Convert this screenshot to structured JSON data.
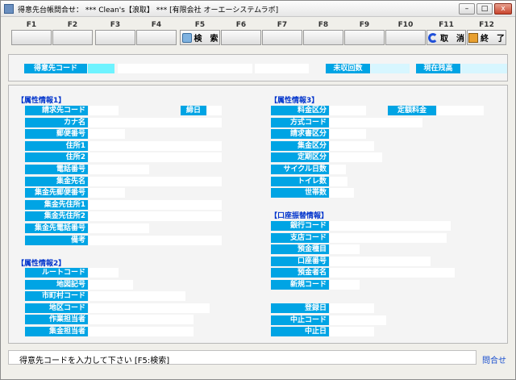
{
  "window": {
    "title": "得意先台帳問合せ：  *** Clean's【浪取】 *** [有限会社  オーエーシステムラボ]",
    "minimize": "–",
    "maximize": "□",
    "close": "x"
  },
  "fkeys": [
    {
      "key": "F1",
      "label": ""
    },
    {
      "key": "F2",
      "label": ""
    },
    {
      "key": "F3",
      "label": ""
    },
    {
      "key": "F4",
      "label": ""
    },
    {
      "key": "F5",
      "label": "検　索",
      "icon": "search-icon"
    },
    {
      "key": "F6",
      "label": ""
    },
    {
      "key": "F7",
      "label": ""
    },
    {
      "key": "F8",
      "label": ""
    },
    {
      "key": "F9",
      "label": ""
    },
    {
      "key": "F10",
      "label": ""
    },
    {
      "key": "F11",
      "label": "取　消",
      "icon": "undo-icon"
    },
    {
      "key": "F12",
      "label": "終　了",
      "icon": "exit-icon"
    }
  ],
  "header": {
    "customer_code_label": "得意先コード",
    "customer_code_value": "",
    "unpaid_count_label": "未収回数",
    "current_balance_label": "現在残高"
  },
  "attr1": {
    "title": "【属性情報1】",
    "labels": [
      "請求先コード",
      "カナ名",
      "郵便番号",
      "住所1",
      "住所2",
      "電話番号",
      "集金先名",
      "集金先郵便番号",
      "集金先住所1",
      "集金先住所2",
      "集金先電話番号",
      "備考"
    ],
    "closing_label": "締日"
  },
  "attr2": {
    "title": "【属性情報2】",
    "labels": [
      "ルートコード",
      "地図記号",
      "市町村コード",
      "地区コード",
      "作業担当者",
      "集金担当者"
    ]
  },
  "attr3": {
    "title": "【属性情報3】",
    "labels": [
      "料金区分",
      "方式コード",
      "請求書区分",
      "集金区分",
      "定期区分",
      "サイクル日数",
      "トイレ数",
      "世帯数"
    ],
    "fixed_fee_label": "定額料金"
  },
  "bank": {
    "title": "【口座振替情報】",
    "labels": [
      "銀行コード",
      "支店コード",
      "預金種目",
      "口座番号",
      "預金者名",
      "新規コード"
    ]
  },
  "dates": {
    "labels": [
      "登録日",
      "中止コード",
      "中止日"
    ]
  },
  "status": {
    "message": "得意先コードを入力して下さい [F5:検索]",
    "inquiry": "問合せ"
  },
  "colors": {
    "label_bg": "#00a4e4",
    "section_title": "#0033cc",
    "input_bg": "#ffffff",
    "code_cell": "#6ef3ff",
    "balance_cell": "#d7f6ff"
  }
}
